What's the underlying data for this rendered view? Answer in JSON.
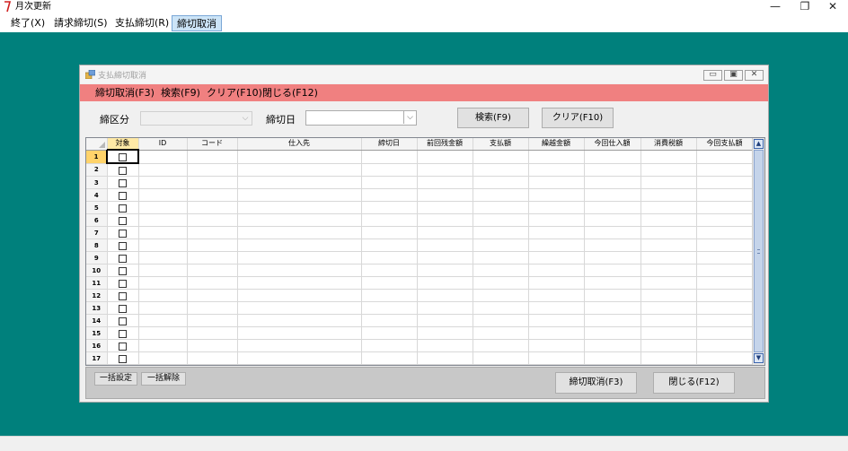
{
  "app": {
    "title": "月次更新",
    "window_controls": {
      "minimize": "—",
      "restore": "❐",
      "close": "✕"
    }
  },
  "menubar": {
    "items": [
      {
        "label": "終了(X)"
      },
      {
        "label": "請求締切(S)"
      },
      {
        "label": "支払締切(R)"
      },
      {
        "label": "締切取消"
      }
    ]
  },
  "dialog": {
    "title": "支払締切取消",
    "controls": {
      "minimize": "▭",
      "restore": "▣",
      "close": "✕"
    },
    "menu": [
      {
        "label": "締切取消(F3)"
      },
      {
        "label": "検索(F9)"
      },
      {
        "label": "クリア(F10)"
      },
      {
        "label": "閉じる(F12)"
      }
    ],
    "filters": {
      "shime_kubun_label": "締区分",
      "shime_kubun_value": "",
      "shime_date_label": "締切日",
      "shime_date_value": "",
      "search_button": "検索(F9)",
      "clear_button": "クリア(F10)"
    },
    "grid": {
      "columns": [
        "対象",
        "ID",
        "コード",
        "仕入先",
        "締切日",
        "前回残金額",
        "支払額",
        "繰越金額",
        "今回仕入額",
        "消費税額",
        "今回支払額"
      ],
      "rows": [
        "1",
        "2",
        "3",
        "4",
        "5",
        "6",
        "7",
        "8",
        "9",
        "10",
        "11",
        "12",
        "13",
        "14",
        "15",
        "16",
        "17"
      ],
      "selected_row": "1"
    },
    "footer": {
      "select_all": "一括設定",
      "deselect_all": "一括解除",
      "cancel_close": "締切取消(F3)",
      "close": "閉じる(F12)"
    },
    "colors": {
      "menu_bg": "#f08080",
      "desktop_bg": "#00807c"
    }
  }
}
